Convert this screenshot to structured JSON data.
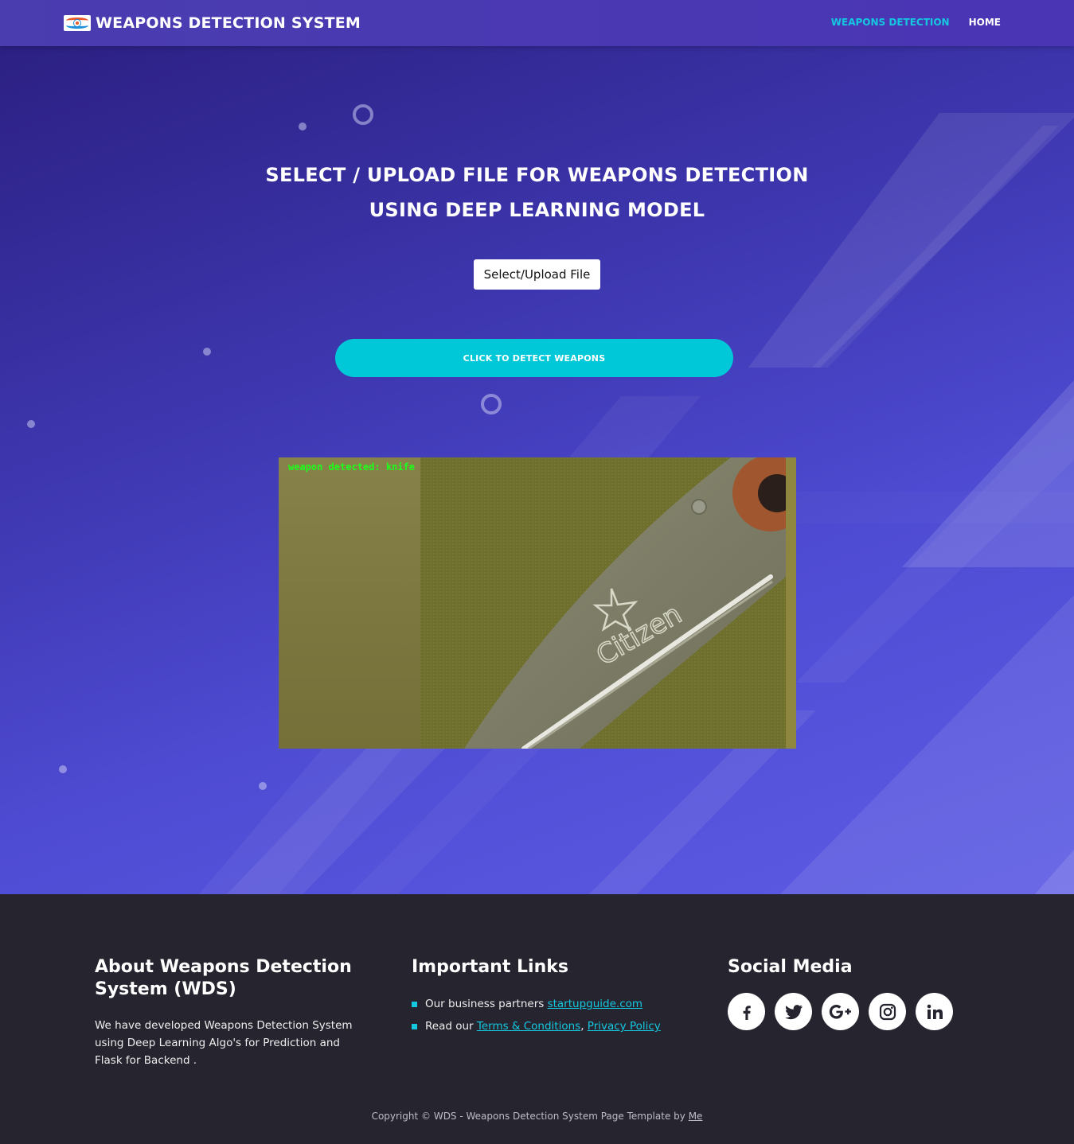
{
  "navbar": {
    "brand": "WEAPONS DETECTION SYSTEM",
    "links": [
      {
        "label": "WEAPONS DETECTION",
        "active": true
      },
      {
        "label": "HOME",
        "active": false
      }
    ],
    "accent_color": "#14c8e0"
  },
  "hero": {
    "title_line1": "SELECT / UPLOAD FILE FOR WEAPONS DETECTION",
    "title_line2": "USING DEEP LEARNING MODEL",
    "upload_button": "Select/Upload File",
    "detect_button": "CLICK TO DETECT WEAPONS",
    "result": {
      "label": "weapon detected: knife",
      "blade_text": "Citizen"
    }
  },
  "footer": {
    "about": {
      "heading": "About Weapons Detection System (WDS)",
      "text": "We have developed Weapons Detection System using Deep Learning Algo's for Prediction and Flask for Backend ."
    },
    "links": {
      "heading": "Important Links",
      "item1_prefix": "Our business partners ",
      "item1_link": "startupguide.com",
      "item2_prefix": "Read our ",
      "item2_link1": "Terms & Conditions",
      "item2_sep": ", ",
      "item2_link2": "Privacy Policy"
    },
    "social": {
      "heading": "Social Media",
      "icons": [
        "facebook-icon",
        "twitter-icon",
        "google-plus-icon",
        "instagram-icon",
        "linkedin-icon"
      ]
    },
    "copyright_text": "Copyright © WDS - Weapons Detection System Page Template by ",
    "copyright_link": "Me"
  }
}
